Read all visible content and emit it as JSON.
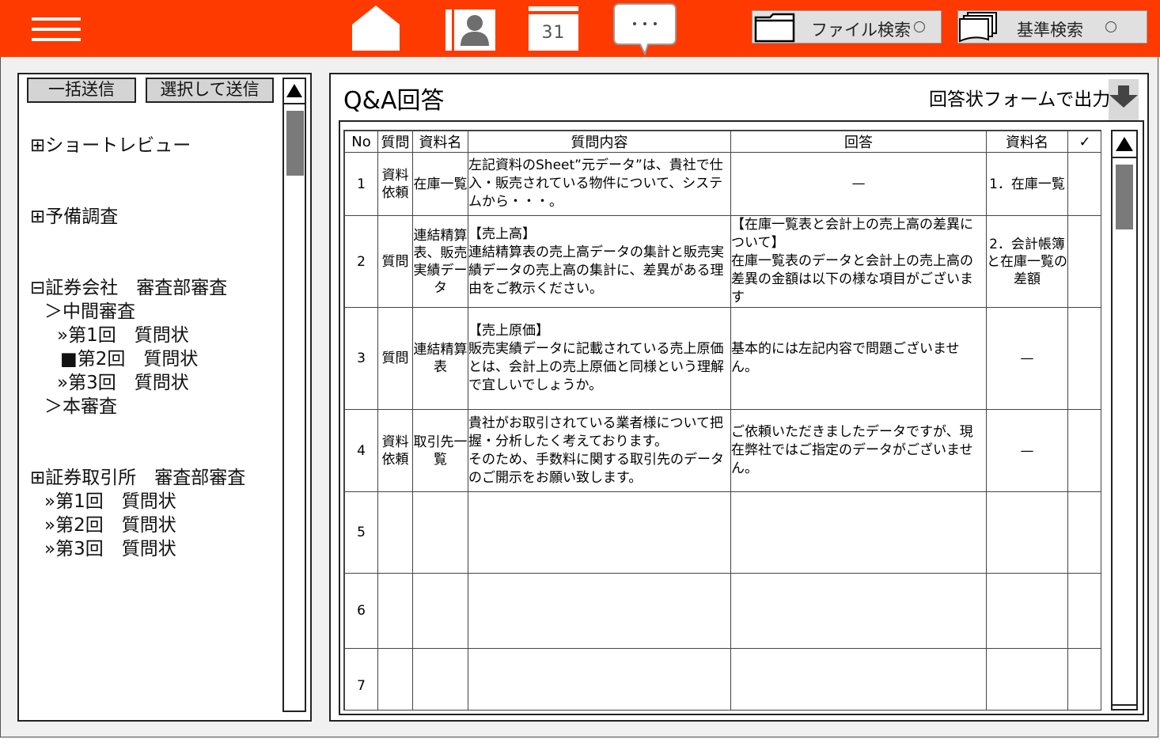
{
  "header": {
    "calendar_day": "31",
    "chat_dots": "···",
    "file_search_label": "ファイル検索",
    "criteria_search_label": "基準検索"
  },
  "sidebar": {
    "bulk_send": "一括送信",
    "select_send": "選択して送信",
    "tree": [
      "⊞ショートレビュー",
      "⊞予備調査",
      "⊟証券会社　審査部審査",
      "＞中間審査",
      "»第1回　質問状",
      "■第2回　質問状",
      "»第3回　質問状",
      "＞本審査",
      "⊞証券取引所　審査部審査",
      "»第1回　質問状",
      "»第2回　質問状",
      "»第3回　質問状"
    ]
  },
  "main": {
    "title": "Q&A回答",
    "export_label": "回答状フォームで出力",
    "columns": [
      "No",
      "質問",
      "資料名",
      "質問内容",
      "回答",
      "資料名",
      "✓"
    ],
    "rows": [
      {
        "no": "1",
        "type": "資料依頼",
        "doc": "在庫一覧",
        "question": "左記資料のSheet”元データ”は、貴社で仕入・販売されている物件について、システムから・・・。",
        "answer": "—",
        "ref": "1．在庫一覧",
        "check": ""
      },
      {
        "no": "2",
        "type": "質問",
        "doc": "連結精算表、販売実績データ",
        "question": "【売上高】\n連結精算表の売上高データの集計と販売実績データの売上高の集計に、差異がある理由をご教示ください。",
        "answer": "【在庫一覧表と会計上の売上高の差異について】\n在庫一覧表のデータと会計上の売上高の差異の金額は以下の様な項目がございます",
        "ref": "2．会計帳簿と在庫一覧の差額",
        "check": ""
      },
      {
        "no": "3",
        "type": "質問",
        "doc": "連結精算表",
        "question": "【売上原価】\n販売実績データに記載されている売上原価とは、会計上の売上原価と同様という理解で宜しいでしょうか。",
        "answer": "基本的には左記内容で問題ございません。",
        "ref": "—",
        "check": ""
      },
      {
        "no": "4",
        "type": "資料依頼",
        "doc": "取引先一覧",
        "question": "貴社がお取引されている業者様について把握・分析したく考えております。\nそのため、手数料に関する取引先のデータのご開示をお願い致します。",
        "answer": "ご依頼いただきましたデータですが、現在弊社ではご指定のデータがございません。",
        "ref": "—",
        "check": ""
      },
      {
        "no": "5",
        "type": "",
        "doc": "",
        "question": "",
        "answer": "",
        "ref": "",
        "check": ""
      },
      {
        "no": "6",
        "type": "",
        "doc": "",
        "question": "",
        "answer": "",
        "ref": "",
        "check": ""
      },
      {
        "no": "7",
        "type": "",
        "doc": "",
        "question": "",
        "answer": "",
        "ref": "",
        "check": ""
      }
    ]
  },
  "colors": {
    "header_bg": "#ff3a00",
    "button_bg": "#e0e0e0",
    "scroll_thumb": "#7a7a7a"
  }
}
